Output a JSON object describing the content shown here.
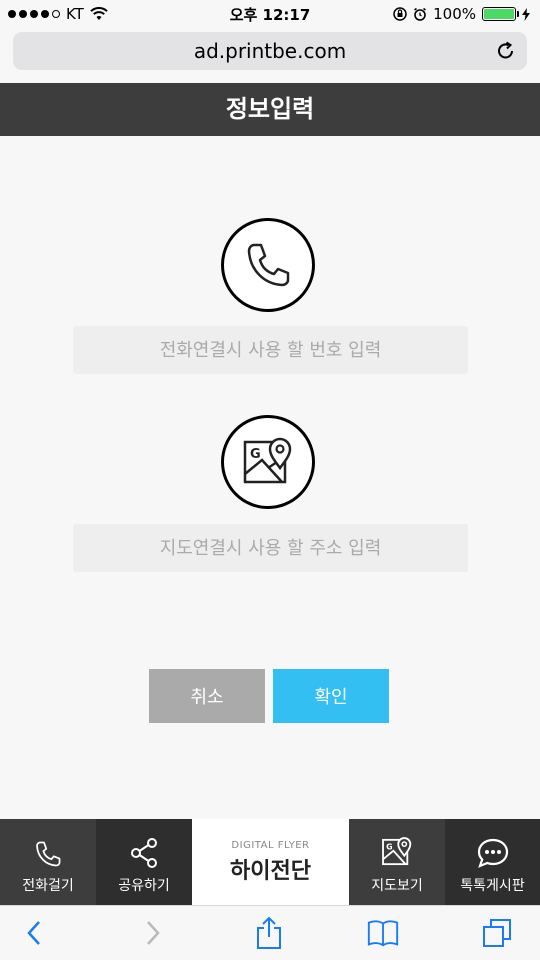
{
  "status_bar": {
    "carrier": "KT",
    "time": "오후 12:17",
    "battery": "100%",
    "battery_level": 1.0
  },
  "browser": {
    "url": "ad.printbe.com"
  },
  "page": {
    "title": "정보입력",
    "phone_input": {
      "placeholder": "전화연결시 사용 할 번호 입력",
      "value": ""
    },
    "address_input": {
      "placeholder": "지도연결시 사용 할 주소 입력",
      "value": ""
    },
    "cancel_label": "취소",
    "confirm_label": "확인"
  },
  "tabs": {
    "call": "전화걸기",
    "share": "공유하기",
    "brand_sub": "DIGITAL FLYER",
    "brand_main": "하이전단",
    "map": "지도보기",
    "board": "톡톡게시판"
  },
  "colors": {
    "title_bar": "#3d3d3d",
    "confirm": "#33bff2",
    "cancel": "#aaaaaa",
    "ios_blue": "#1a7cf5"
  }
}
